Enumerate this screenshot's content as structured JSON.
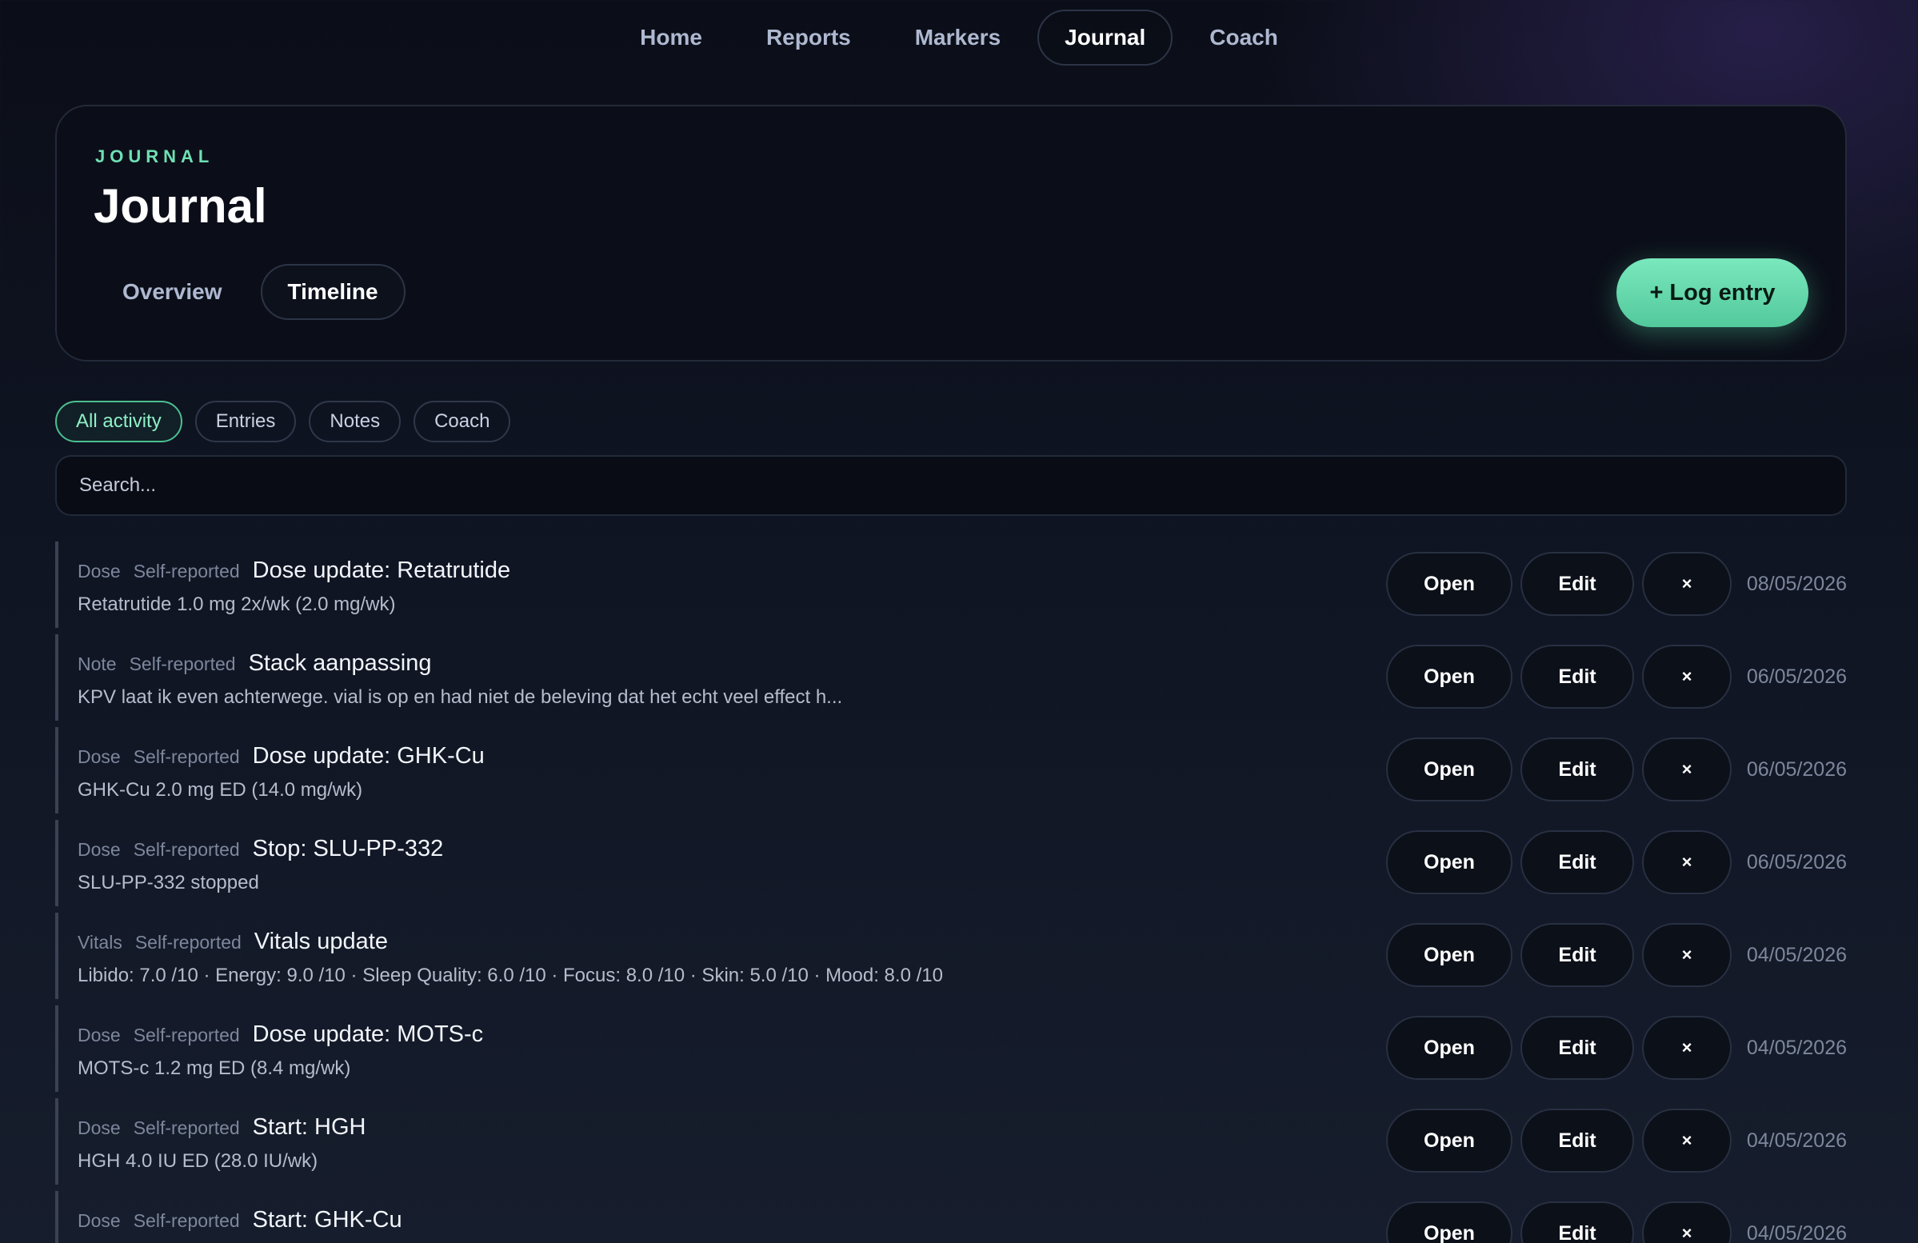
{
  "nav": {
    "items": [
      {
        "label": "Home"
      },
      {
        "label": "Reports"
      },
      {
        "label": "Markers"
      },
      {
        "label": "Journal"
      },
      {
        "label": "Coach"
      }
    ],
    "active": "Journal"
  },
  "header": {
    "eyebrow": "JOURNAL",
    "title": "Journal",
    "tabs": [
      {
        "label": "Overview"
      },
      {
        "label": "Timeline"
      }
    ],
    "active_tab": "Timeline",
    "log_button": "+ Log entry"
  },
  "filters": {
    "chips": [
      {
        "label": "All activity"
      },
      {
        "label": "Entries"
      },
      {
        "label": "Notes"
      },
      {
        "label": "Coach"
      }
    ],
    "active": "All activity"
  },
  "search": {
    "placeholder": "Search..."
  },
  "actions": {
    "open_label": "Open",
    "edit_label": "Edit",
    "delete_label": "×"
  },
  "entries": [
    {
      "type": "Dose",
      "source": "Self-reported",
      "title": "Dose update: Retatrutide",
      "description": "Retatrutide 1.0 mg 2x/wk (2.0 mg/wk)",
      "date": "08/05/2026"
    },
    {
      "type": "Note",
      "source": "Self-reported",
      "title": "Stack aanpassing",
      "description": "KPV laat ik even achterwege. vial is op en had niet de beleving dat het echt veel effect h...",
      "date": "06/05/2026"
    },
    {
      "type": "Dose",
      "source": "Self-reported",
      "title": "Dose update: GHK-Cu",
      "description": "GHK-Cu 2.0 mg ED (14.0 mg/wk)",
      "date": "06/05/2026"
    },
    {
      "type": "Dose",
      "source": "Self-reported",
      "title": "Stop: SLU-PP-332",
      "description": "SLU-PP-332 stopped",
      "date": "06/05/2026"
    },
    {
      "type": "Vitals",
      "source": "Self-reported",
      "title": "Vitals update",
      "description": "Libido: 7.0 /10 · Energy: 9.0 /10 · Sleep Quality: 6.0 /10 · Focus: 8.0 /10 · Skin: 5.0 /10 · Mood: 8.0 /10",
      "date": "04/05/2026"
    },
    {
      "type": "Dose",
      "source": "Self-reported",
      "title": "Dose update: MOTS-c",
      "description": "MOTS-c 1.2 mg ED (8.4 mg/wk)",
      "date": "04/05/2026"
    },
    {
      "type": "Dose",
      "source": "Self-reported",
      "title": "Start: HGH",
      "description": "HGH 4.0 IU ED (28.0 IU/wk)",
      "date": "04/05/2026"
    },
    {
      "type": "Dose",
      "source": "Self-reported",
      "title": "Start: GHK-Cu",
      "description": "",
      "date": "04/05/2026"
    }
  ]
}
